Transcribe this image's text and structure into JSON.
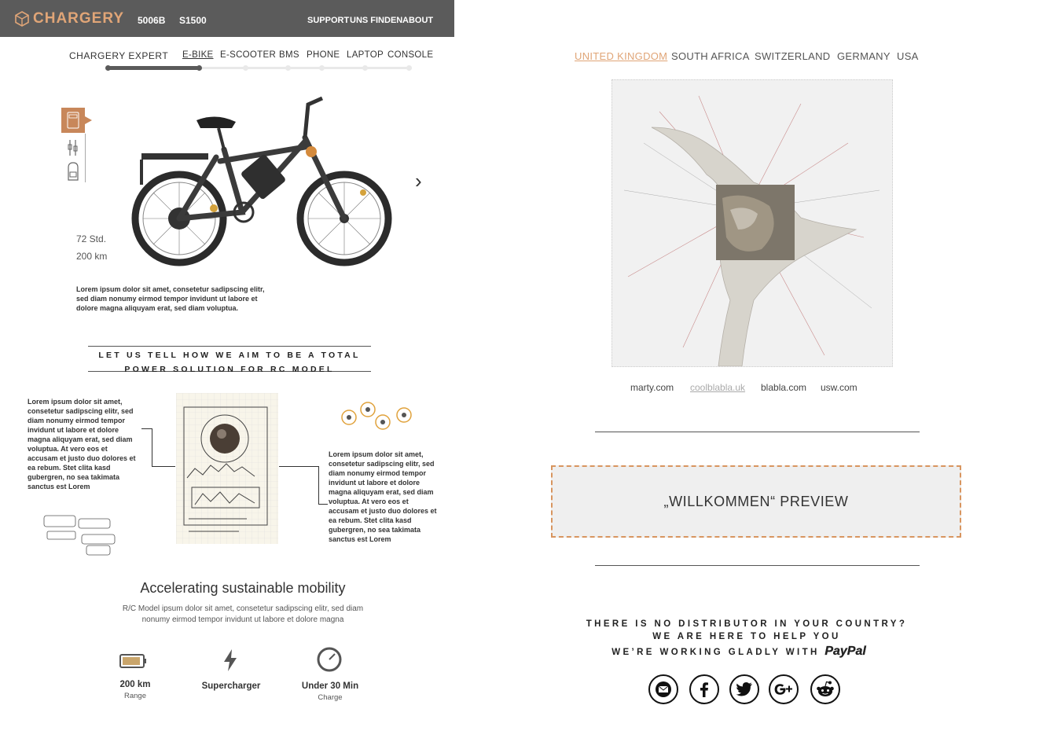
{
  "header": {
    "logo": "CHARGERY",
    "nav_left": [
      "5006B",
      "S1500"
    ],
    "nav_right": [
      "SUPPORT",
      "UNS FINDEN",
      "ABOUT"
    ]
  },
  "subnav": {
    "label": "CHARGERY EXPERT",
    "items": [
      "E-BIKE",
      "E-SCOOTER",
      "BMS",
      "PHONE",
      "LAPTOP",
      "CONSOLE"
    ],
    "active": "E-BIKE"
  },
  "product": {
    "stats": [
      "72 Std.",
      "200 km"
    ],
    "description": "Lorem ipsum dolor sit amet, consetetur sadipscing elitr, sed diam nonumy eirmod tempor invidunt ut labore et dolore magna aliquyam erat, sed diam voluptua.",
    "next_label": "›"
  },
  "aim": {
    "heading_line1": "LET US TELL HOW WE AIM TO BE A TOTAL",
    "heading_line2": "POWER SOLUTION FOR RC MODEL",
    "left_text": "Lorem ipsum dolor sit amet, consetetur sadipscing elitr, sed diam nonumy eirmod tempor invidunt ut labore et dolore magna aliquyam erat, sed diam voluptua. At vero eos et accusam et justo duo dolores et ea rebum. Stet clita kasd gubergren, no sea takimata sanctus est Lorem",
    "right_text": "Lorem ipsum dolor sit amet, consetetur sadipscing elitr, sed diam nonumy eirmod tempor invidunt ut labore et dolore magna aliquyam erat, sed diam voluptua. At vero eos et accusam et justo duo dolores et ea rebum. Stet clita kasd gubergren, no sea takimata sanctus est Lorem"
  },
  "mobility": {
    "title": "Accelerating sustainable mobility",
    "description": "R/C Model ipsum dolor sit amet, consetetur sadipscing elitr, sed diam nonumy eirmod tempor invidunt ut labore et dolore magna",
    "features": [
      {
        "title": "200 km",
        "sub": "Range"
      },
      {
        "title": "Supercharger",
        "sub": ""
      },
      {
        "title": "Under 30 Min",
        "sub": "Charge"
      }
    ]
  },
  "countries": {
    "items": [
      "UNITED KINGDOM",
      "SOUTH AFRICA",
      "SWITZERLAND",
      "GERMANY",
      "USA"
    ],
    "active": "UNITED KINGDOM"
  },
  "domains": {
    "items": [
      "marty.com",
      "coolblabla.uk",
      "blabla.com",
      "usw.com"
    ],
    "active": "coolblabla.uk"
  },
  "welcome": {
    "label": "„WILLKOMMEN“ PREVIEW"
  },
  "distributor": {
    "line1": "THERE IS NO DISTRIBUTOR IN YOUR COUNTRY?",
    "line2": "WE ARE HERE TO HELP YOU",
    "line3": "WE’RE WORKING GLADLY WITH",
    "paypal": "PayPal"
  },
  "social": [
    "mail-icon",
    "facebook-icon",
    "twitter-icon",
    "google-plus-icon",
    "reddit-icon"
  ],
  "colors": {
    "accent": "#e0a577",
    "topbar": "#5b5b5b",
    "dashed_border": "#d8955f"
  }
}
